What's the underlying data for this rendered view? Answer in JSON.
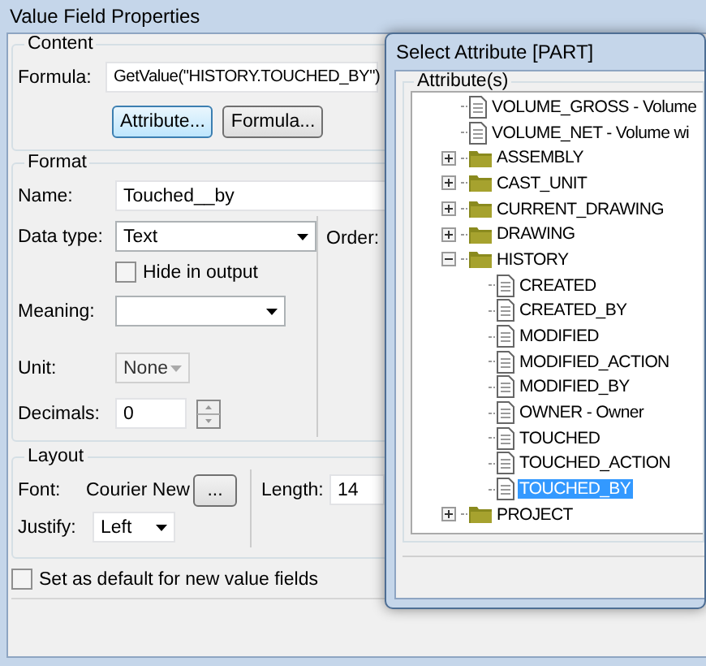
{
  "window": {
    "title": "Value Field Properties"
  },
  "content": {
    "title": "Content",
    "formula_label": "Formula:",
    "formula": "GetValue(\"HISTORY.TOUCHED_BY\")",
    "buttons": [
      {
        "label": "Attribute...",
        "focused": true
      },
      {
        "label": "Formula...",
        "focused": false
      }
    ]
  },
  "format": {
    "title": "Format",
    "name_label": "Name:",
    "name": "Touched__by",
    "data_type_label": "Data type:",
    "data_type": "Text",
    "order_label": "Order:",
    "hide_in_output": {
      "label": "Hide in output",
      "checked": false
    },
    "meaning_label": "Meaning:",
    "unit_label": "Unit:",
    "unit": {
      "value": "None",
      "disabled": true
    },
    "decimals_label": "Decimals:",
    "decimals": "0"
  },
  "layout": {
    "title": "Layout",
    "font_label": "Font:",
    "font": "Courier New",
    "font_button": "...",
    "length_label": "Length:",
    "length": "14",
    "justify_label": "Justify:",
    "justify": "Left"
  },
  "default_checkbox": {
    "label": "Set as default for new value fields",
    "checked": false
  },
  "attribute_dialog": {
    "title": "Select Attribute [PART]",
    "group_title": "Attribute(s)",
    "tree": [
      {
        "kind": "attribute",
        "label": "VOLUME_GROSS  -  Volume",
        "selected": false
      },
      {
        "kind": "attribute",
        "label": "VOLUME_NET  -  Volume wi",
        "selected": false
      },
      {
        "kind": "folder",
        "label": "ASSEMBLY",
        "expanded": false,
        "selected": false
      },
      {
        "kind": "folder",
        "label": "CAST_UNIT",
        "expanded": false,
        "selected": false
      },
      {
        "kind": "folder",
        "label": "CURRENT_DRAWING",
        "expanded": false,
        "selected": false
      },
      {
        "kind": "folder",
        "label": "DRAWING",
        "expanded": false,
        "selected": false
      },
      {
        "kind": "folder",
        "label": "HISTORY",
        "expanded": true,
        "selected": false,
        "children": [
          {
            "kind": "attribute",
            "label": "CREATED",
            "selected": false
          },
          {
            "kind": "attribute",
            "label": "CREATED_BY",
            "selected": false
          },
          {
            "kind": "attribute",
            "label": "MODIFIED",
            "selected": false
          },
          {
            "kind": "attribute",
            "label": "MODIFIED_ACTION",
            "selected": false
          },
          {
            "kind": "attribute",
            "label": "MODIFIED_BY",
            "selected": false
          },
          {
            "kind": "attribute",
            "label": "OWNER  -  Owner",
            "selected": false
          },
          {
            "kind": "attribute",
            "label": "TOUCHED",
            "selected": false
          },
          {
            "kind": "attribute",
            "label": "TOUCHED_ACTION",
            "selected": false
          },
          {
            "kind": "attribute",
            "label": "TOUCHED_BY",
            "selected": true
          }
        ]
      },
      {
        "kind": "folder",
        "label": "PROJECT",
        "expanded": false,
        "selected": false
      }
    ]
  }
}
